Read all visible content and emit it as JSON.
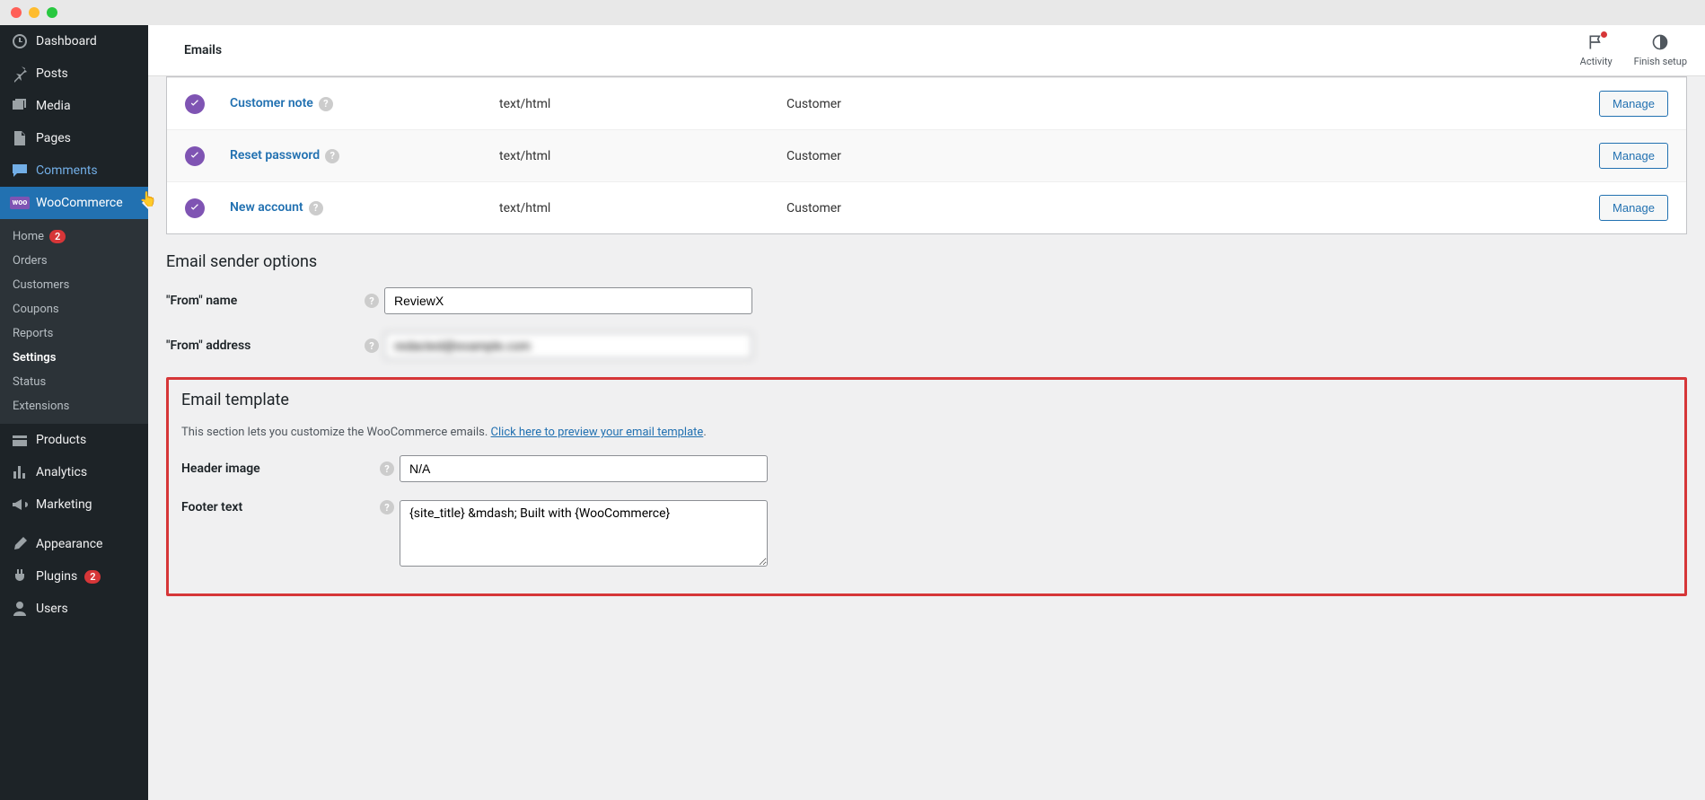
{
  "sidebar": {
    "items": [
      {
        "label": "Dashboard"
      },
      {
        "label": "Posts"
      },
      {
        "label": "Media"
      },
      {
        "label": "Pages"
      },
      {
        "label": "Comments"
      },
      {
        "label": "WooCommerce"
      },
      {
        "label": "Products"
      },
      {
        "label": "Analytics"
      },
      {
        "label": "Marketing"
      },
      {
        "label": "Appearance"
      },
      {
        "label": "Plugins"
      },
      {
        "label": "Users"
      }
    ],
    "submenu": [
      {
        "label": "Home",
        "badge": "2"
      },
      {
        "label": "Orders"
      },
      {
        "label": "Customers"
      },
      {
        "label": "Coupons"
      },
      {
        "label": "Reports"
      },
      {
        "label": "Settings"
      },
      {
        "label": "Status"
      },
      {
        "label": "Extensions"
      }
    ],
    "plugins_badge": "2"
  },
  "topbar": {
    "title": "Emails",
    "activity_label": "Activity",
    "finish_label": "Finish setup"
  },
  "emails": [
    {
      "name": "Customer note",
      "ct": "text/html",
      "rec": "Customer",
      "manage": "Manage"
    },
    {
      "name": "Reset password",
      "ct": "text/html",
      "rec": "Customer",
      "manage": "Manage"
    },
    {
      "name": "New account",
      "ct": "text/html",
      "rec": "Customer",
      "manage": "Manage"
    }
  ],
  "sender": {
    "heading": "Email sender options",
    "from_name_label": "\"From\" name",
    "from_name_value": "ReviewX",
    "from_addr_label": "\"From\" address",
    "from_addr_value": "redacted@example.com"
  },
  "template": {
    "heading": "Email template",
    "desc_prefix": "This section lets you customize the WooCommerce emails. ",
    "desc_link": "Click here to preview your email template",
    "header_label": "Header image",
    "header_value": "N/A",
    "footer_label": "Footer text",
    "footer_value": "{site_title} &mdash; Built with {WooCommerce}"
  }
}
